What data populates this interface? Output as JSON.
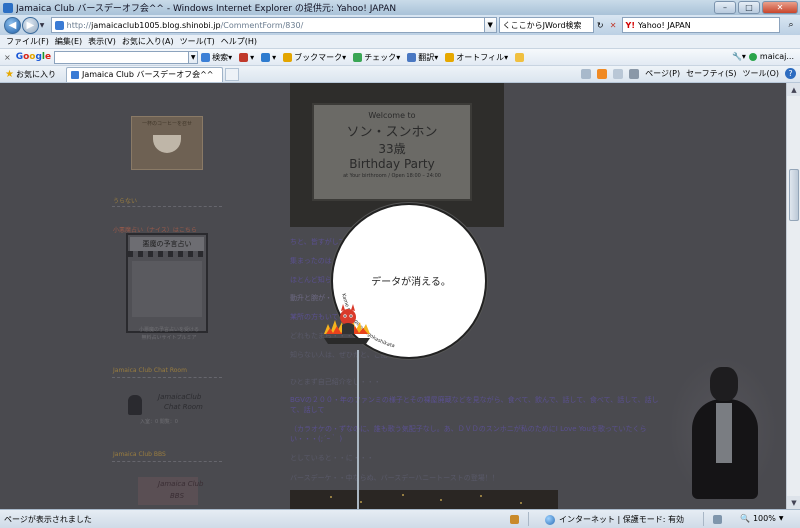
{
  "window": {
    "title": "Jamaica Club バースデーオフ会^^ - Windows Internet Explorer の提供元: Yahoo! JAPAN",
    "minimize": "–",
    "maximize": "□",
    "close": "✕"
  },
  "address_bar": {
    "url_prefix": "http://",
    "url_host": "jamaicaclub1005.blog.shinobi.jp",
    "url_path": "/CommentForm/830/",
    "jword_label": "くここからJWord検索",
    "yahoo_label": "Yahoo! JAPAN"
  },
  "menu": [
    "ファイル(F)",
    "編集(E)",
    "表示(V)",
    "お気に入り(A)",
    "ツール(T)",
    "ヘルプ(H)"
  ],
  "google_toolbar": {
    "close": "×",
    "logo": [
      "G",
      "o",
      "o",
      "g",
      "l",
      "e"
    ],
    "search_button": "検索",
    "bookmarks": "ブックマーク",
    "check": "チェック",
    "translate": "翻訳",
    "autofill": "オートフィル",
    "account": "maicaj..."
  },
  "favorites_bar": {
    "favorites_label": "お気に入り",
    "tab_label": "Jamaica Club バースデーオフ会^^"
  },
  "command_bar": {
    "page": "ページ(P)",
    "safety": "セーフティ(S)",
    "tools": "ツール(O)",
    "help": "?"
  },
  "sidebar": {
    "coffee_caption": "一杯のコーヒーを召せ",
    "fortune_header": "うらない",
    "fortune_subheader": "小悪魔占い（ナイス）はこちら",
    "fortune_title": "悪魔の予言占い",
    "fortune_caption_1": "小悪魔の予言占いを受ける",
    "fortune_caption_2": "無料占いサイトプルミア",
    "chat_header": "Jamaica Club Chat Room",
    "chat_line1": "JamaicaClub",
    "chat_line2": "Chat Room",
    "chat_status": "入室：0 閲覧：0",
    "bbs_header": "Jamaica Club BBS",
    "bbs_line1": "Jamaica Club",
    "bbs_line2": "BBS"
  },
  "sign": {
    "welcome": "Welcome to",
    "name": "ソン・スンホン",
    "age": "33歳",
    "party": "Birthday Party",
    "details": "at Your birthroom / Open 18:00 – 24:00"
  },
  "blog_lines": [
    "ちと、皆すがしてます・・・",
    "集まったのは・・・",
    "ほとんど知らない・・・",
    "動升と腕が・・・・・・・・・・・・・",
    "某所の方もいて・・・",
    "どれもたまら・・・",
    "知らない人は、ぜひだと、ご話を・・・",
    "ひとまず自己紹介をし・・・",
    "BGVの２００・年のファンミの様子とその裸屋廃蔵などを見ながら、食べて、飲んで、話して、食べて、話して、話して、話して",
    "（カラオケの・ずなのに、誰も歌う気配子なし。あ、ＤＶＤのスンホニが私のためにI Love Youを歌っていたくらい・・・(;´ｰ｀ )",
    "としていると・・に・・・",
    "バースデーケ・・中ならぬ、バースデーハニートーストの登場！！"
  ],
  "overlay": {
    "message": "データが消える。",
    "ring_text": "Kame no page no ugokashikata"
  },
  "status_bar": {
    "status": "ページが表示されました",
    "zone": "インターネット | 保護モード: 有効",
    "zoom": "100%"
  }
}
